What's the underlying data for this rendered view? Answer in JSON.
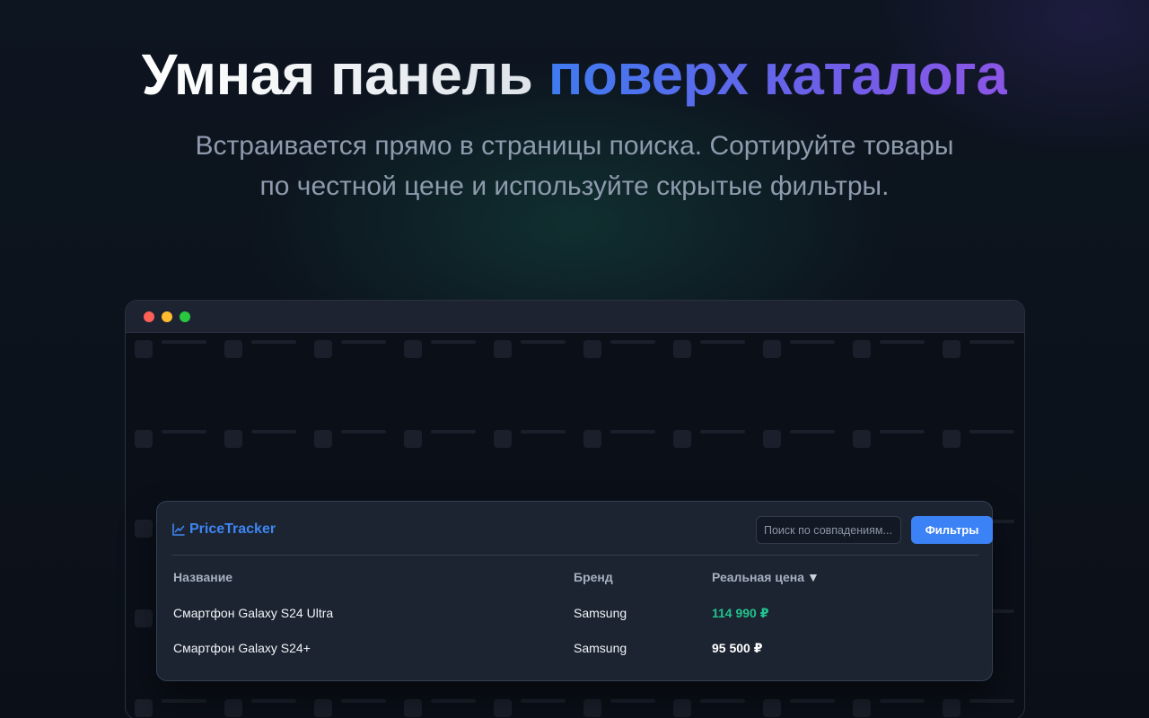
{
  "hero": {
    "title_plain": "Умная панель",
    "title_accent": "поверх каталога",
    "subtitle": "Встраивается прямо в страницы поиска. Сортируйте товары по честной цене и используйте скрытые фильтры."
  },
  "panel": {
    "brand_name": "PriceTracker",
    "brand_icon": "trend-chart-icon",
    "search_placeholder": "Поиск по совпадениям...",
    "filter_button": "Фильтры",
    "columns": {
      "name": "Название",
      "brand": "Бренд",
      "price": "Реальная цена",
      "price_sort_glyph": "▼"
    },
    "rows": [
      {
        "name": "Смартфон Galaxy S24 Ultra",
        "brand": "Samsung",
        "price": "114 990 ₽"
      },
      {
        "name": "Смартфон Galaxy S24+",
        "brand": "Samsung",
        "price": "95 500 ₽"
      }
    ]
  },
  "colors": {
    "accent_blue": "#3b82f6",
    "price_highlight": "#22c38e",
    "window_close": "#ff5f57",
    "window_minimize": "#febc2e",
    "window_maximize": "#28c840"
  }
}
